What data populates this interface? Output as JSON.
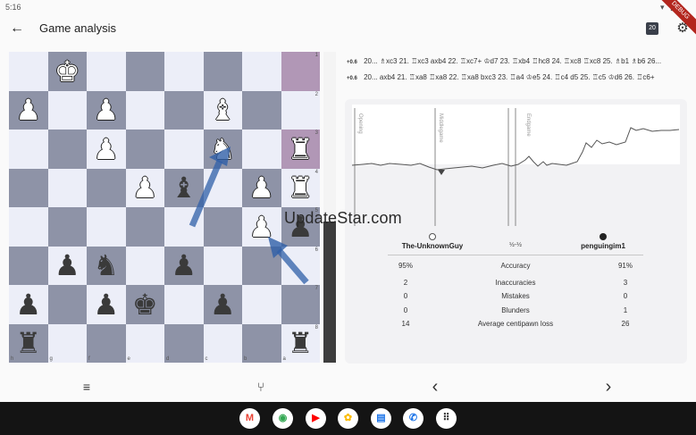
{
  "status": {
    "time": "5:16",
    "ribbon": "DEBUG"
  },
  "appbar": {
    "title": "Game analysis",
    "depth_badge": "20"
  },
  "board": {
    "rank_labels": [
      "1",
      "2",
      "3",
      "4",
      "5",
      "6",
      "7",
      "8"
    ],
    "file_labels": [
      "h",
      "g",
      "f",
      "e",
      "d",
      "c",
      "b",
      "a"
    ]
  },
  "pgn": {
    "lines": [
      {
        "eval": "+0.6",
        "text": "20... ♗xc3 21. ♖xc3 axb4 22. ♖xc7+ ♔d7 23. ♖xb4 ♖hc8 24. ♖xc8 ♖xc8 25. ♗b1 ♗b6 26..."
      },
      {
        "eval": "+0.6",
        "text": "20... axb4 21. ♖xa8 ♖xa8 22. ♖xa8 bxc3 23. ♖a4 ♔e5 24. ♖c4 d5 25. ♖c5 ♔d6 26. ♖c6+"
      }
    ]
  },
  "graph": {
    "phase_labels": [
      "Opening",
      "Middlegame",
      "Endgame"
    ]
  },
  "summary": {
    "white_player": "The-UnknownGuy",
    "black_player": "penguingim1",
    "result": "½-½",
    "rows": [
      {
        "left": "95%",
        "label": "Accuracy",
        "right": "91%"
      },
      {
        "left": "2",
        "label": "Inaccuracies",
        "right": "3"
      },
      {
        "left": "0",
        "label": "Mistakes",
        "right": "0"
      },
      {
        "left": "0",
        "label": "Blunders",
        "right": "1"
      },
      {
        "left": "14",
        "label": "Average centipawn loss",
        "right": "26"
      }
    ]
  },
  "watermark": "UpdateStar.com",
  "icons": {
    "back": "←",
    "settings": "⚙",
    "menu": "≡",
    "branch": "⑂",
    "prev": "‹",
    "next": "›",
    "dock": [
      {
        "name": "gmail-icon",
        "glyph": "M",
        "color": "#ea4335"
      },
      {
        "name": "chrome-icon",
        "glyph": "◉",
        "color": "#34a853"
      },
      {
        "name": "youtube-icon",
        "glyph": "▶",
        "color": "#ff0000"
      },
      {
        "name": "photos-icon",
        "glyph": "✿",
        "color": "#fbbc05"
      },
      {
        "name": "messages-icon",
        "glyph": "▤",
        "color": "#1a73e8"
      },
      {
        "name": "phone-icon",
        "glyph": "✆",
        "color": "#1a73e8"
      },
      {
        "name": "app-drawer-icon",
        "glyph": "⠿",
        "color": "#333333"
      }
    ]
  },
  "colors": {
    "accent_arrow": "#2f5fa8",
    "graph_line": "#555555"
  }
}
